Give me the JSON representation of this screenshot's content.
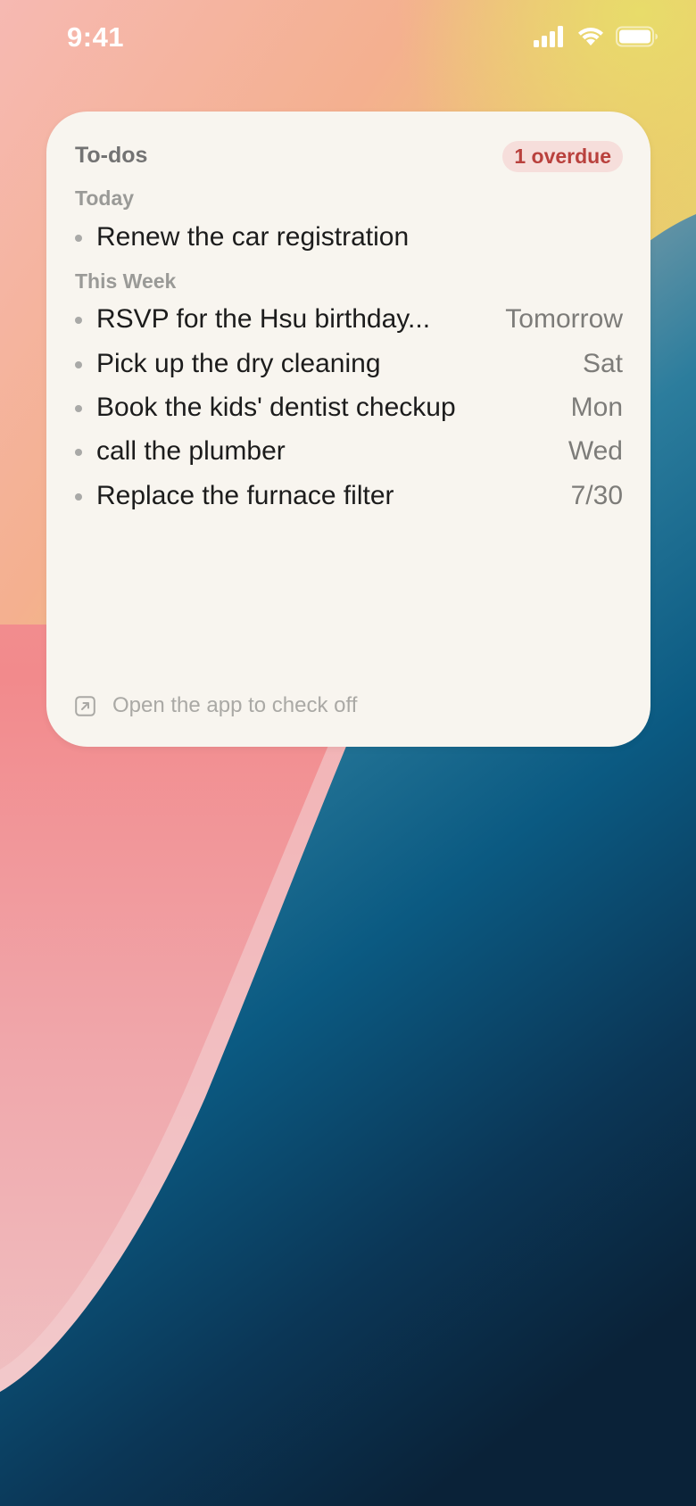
{
  "status_bar": {
    "time": "9:41",
    "icons": [
      "cellular-signal-icon",
      "wifi-icon",
      "battery-icon"
    ]
  },
  "widget": {
    "title": "To-dos",
    "overdue_badge": "1 overdue",
    "sections": [
      {
        "label": "Today",
        "items": [
          {
            "text": "Renew the car registration",
            "due": ""
          }
        ]
      },
      {
        "label": "This Week",
        "items": [
          {
            "text": "RSVP for the Hsu birthday...",
            "due": "Tomorrow"
          },
          {
            "text": "Pick up the dry cleaning",
            "due": "Sat"
          },
          {
            "text": "Book the kids' dentist checkup",
            "due": "Mon"
          },
          {
            "text": "call the plumber",
            "due": "Wed"
          },
          {
            "text": "Replace the furnace filter",
            "due": "7/30"
          }
        ]
      }
    ],
    "footer": {
      "icon": "open-external-icon",
      "text": "Open the app to check off"
    }
  },
  "colors": {
    "widget_background": "#f8f5ef",
    "badge_background": "#f6dedb",
    "badge_text": "#b9413d",
    "wallpaper_pink": "#f2a7a2",
    "wallpaper_yellow": "#e8d06d",
    "wallpaper_blue": "#0e5a82",
    "wallpaper_navy": "#0c2a44"
  }
}
